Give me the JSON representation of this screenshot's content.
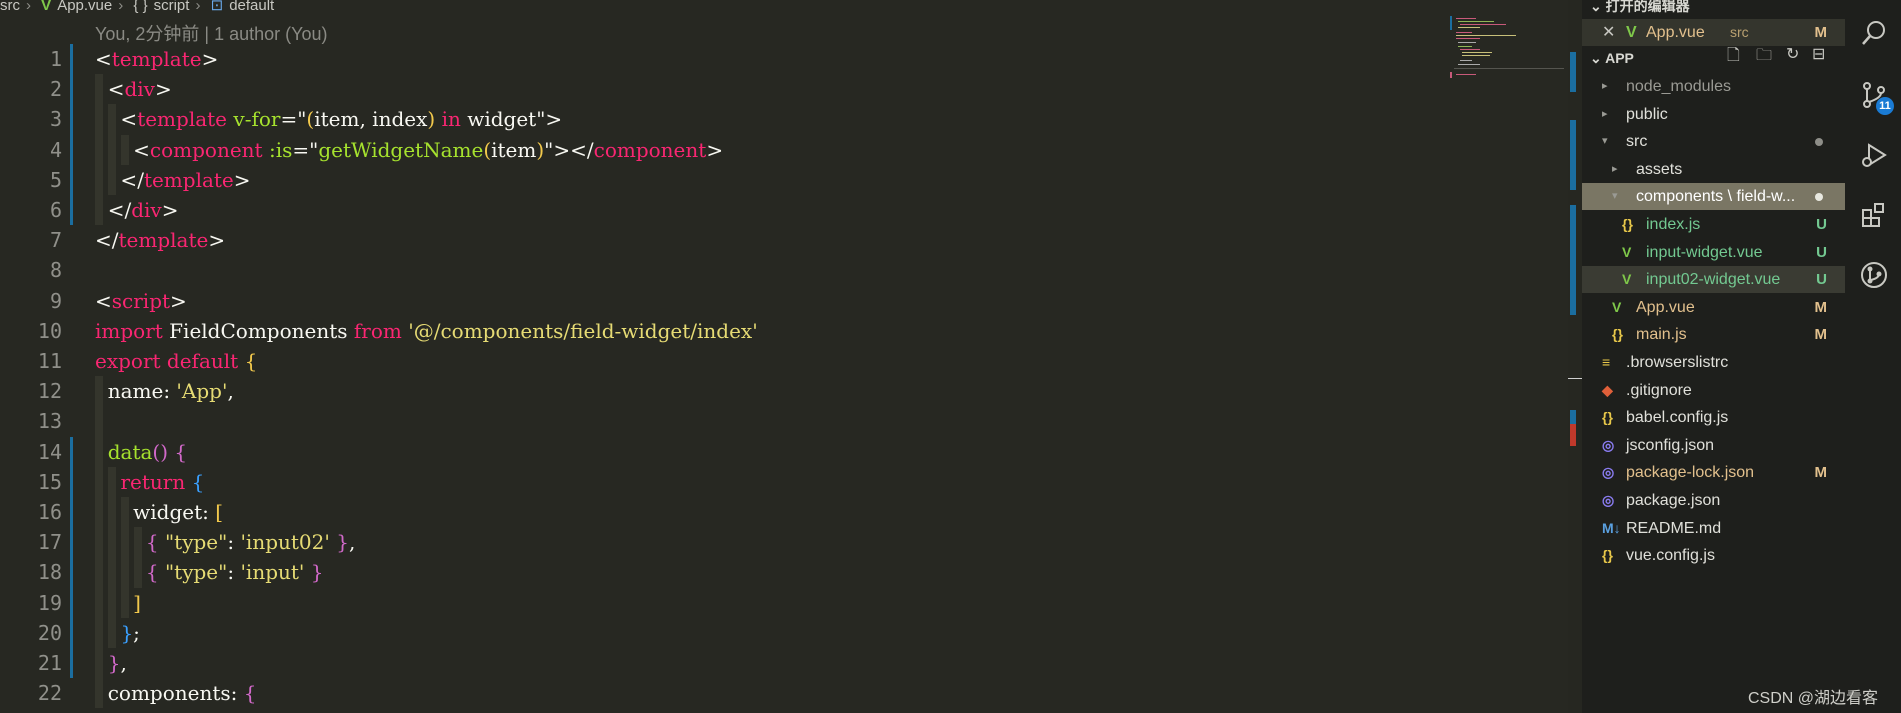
{
  "breadcrumb": {
    "src": "src",
    "file": "App.vue",
    "script_icon": "{ }",
    "script": "script",
    "default": "default"
  },
  "blame": "You, 2分钟前 | 1 author (You)",
  "lines": [
    {
      "n": "1",
      "toks": [
        [
          "pun",
          "<"
        ],
        [
          "tag",
          "template"
        ],
        [
          "pun",
          ">"
        ]
      ]
    },
    {
      "n": "2",
      "toks": [
        [
          "pun",
          "  <"
        ],
        [
          "tag",
          "div"
        ],
        [
          "pun",
          ">"
        ]
      ]
    },
    {
      "n": "3",
      "toks": [
        [
          "pun",
          "    <"
        ],
        [
          "tag",
          "template"
        ],
        [
          "pun",
          " "
        ],
        [
          "attr",
          "v-for"
        ],
        [
          "pun",
          "=\""
        ],
        [
          "yl",
          "("
        ],
        [
          "pun",
          "item, index"
        ],
        [
          "yl",
          ")"
        ],
        [
          "pun",
          " "
        ],
        [
          "kw",
          "in"
        ],
        [
          "pun",
          " widget\">"
        ]
      ]
    },
    {
      "n": "4",
      "toks": [
        [
          "pun",
          "      <"
        ],
        [
          "tag",
          "component"
        ],
        [
          "pun",
          " "
        ],
        [
          "attr",
          ":is"
        ],
        [
          "pun",
          "=\""
        ],
        [
          "fn",
          "getWidgetName"
        ],
        [
          "yl",
          "("
        ],
        [
          "pun",
          "item"
        ],
        [
          "yl",
          ")"
        ],
        [
          "pun",
          "\"></"
        ],
        [
          "tag",
          "component"
        ],
        [
          "pun",
          ">"
        ]
      ]
    },
    {
      "n": "5",
      "toks": [
        [
          "pun",
          "    </"
        ],
        [
          "tag",
          "template"
        ],
        [
          "pun",
          ">"
        ]
      ]
    },
    {
      "n": "6",
      "toks": [
        [
          "pun",
          "  </"
        ],
        [
          "tag",
          "div"
        ],
        [
          "pun",
          ">"
        ]
      ]
    },
    {
      "n": "7",
      "toks": [
        [
          "pun",
          "</"
        ],
        [
          "tag",
          "template"
        ],
        [
          "pun",
          ">"
        ]
      ]
    },
    {
      "n": "8",
      "toks": []
    },
    {
      "n": "9",
      "toks": [
        [
          "pun",
          "<"
        ],
        [
          "tag",
          "script"
        ],
        [
          "pun",
          ">"
        ]
      ]
    },
    {
      "n": "10",
      "toks": [
        [
          "kw",
          "import"
        ],
        [
          "pun",
          " FieldComponents "
        ],
        [
          "kw",
          "from"
        ],
        [
          "pun",
          " "
        ],
        [
          "str",
          "'@/components/field-widget/index'"
        ]
      ]
    },
    {
      "n": "11",
      "toks": [
        [
          "kw",
          "export default"
        ],
        [
          "pun",
          " "
        ],
        [
          "yl",
          "{"
        ]
      ]
    },
    {
      "n": "12",
      "toks": [
        [
          "pun",
          "  name: "
        ],
        [
          "str",
          "'App'"
        ],
        [
          "pun",
          ","
        ]
      ]
    },
    {
      "n": "13",
      "toks": []
    },
    {
      "n": "14",
      "toks": [
        [
          "pun",
          "  "
        ],
        [
          "fn",
          "data"
        ],
        [
          "br",
          "()"
        ],
        [
          "pun",
          " "
        ],
        [
          "br",
          "{"
        ]
      ]
    },
    {
      "n": "15",
      "toks": [
        [
          "pun",
          "    "
        ],
        [
          "kw",
          "return"
        ],
        [
          "pun",
          " "
        ],
        [
          "bb",
          "{"
        ]
      ]
    },
    {
      "n": "16",
      "toks": [
        [
          "pun",
          "      widget: "
        ],
        [
          "yl",
          "["
        ]
      ]
    },
    {
      "n": "17",
      "toks": [
        [
          "pun",
          "        "
        ],
        [
          "br",
          "{"
        ],
        [
          "pun",
          " "
        ],
        [
          "str",
          "\"type\""
        ],
        [
          "pun",
          ": "
        ],
        [
          "str",
          "'input02'"
        ],
        [
          "pun",
          " "
        ],
        [
          "br",
          "}"
        ],
        [
          "pun",
          ","
        ]
      ]
    },
    {
      "n": "18",
      "toks": [
        [
          "pun",
          "        "
        ],
        [
          "br",
          "{"
        ],
        [
          "pun",
          " "
        ],
        [
          "str",
          "\"type\""
        ],
        [
          "pun",
          ": "
        ],
        [
          "str",
          "'input'"
        ],
        [
          "pun",
          " "
        ],
        [
          "br",
          "}"
        ]
      ]
    },
    {
      "n": "19",
      "toks": [
        [
          "pun",
          "      "
        ],
        [
          "yl",
          "]"
        ]
      ]
    },
    {
      "n": "20",
      "toks": [
        [
          "pun",
          "    "
        ],
        [
          "bb",
          "}"
        ],
        [
          "pun",
          ";"
        ]
      ]
    },
    {
      "n": "21",
      "toks": [
        [
          "pun",
          "  "
        ],
        [
          "br",
          "}"
        ],
        [
          "pun",
          ","
        ]
      ]
    },
    {
      "n": "22",
      "toks": [
        [
          "pun",
          "  components: "
        ],
        [
          "br",
          "{"
        ]
      ]
    }
  ],
  "sidebar": {
    "open_editors_title": "打开的编辑器",
    "open_editor": {
      "name": "App.vue",
      "dir": "src",
      "badge": "M"
    },
    "project_title": "APP",
    "items": [
      {
        "label": "node_modules",
        "kind": "folder",
        "depth": 0,
        "color": "#9a9a94",
        "badge": ""
      },
      {
        "label": "public",
        "kind": "folder",
        "depth": 0,
        "color": "#e0e0da",
        "badge": ""
      },
      {
        "label": "src",
        "kind": "folder-open",
        "depth": 0,
        "color": "#e0e0da",
        "badge": "dot"
      },
      {
        "label": "assets",
        "kind": "folder",
        "depth": 1,
        "color": "#e0e0da",
        "badge": ""
      },
      {
        "label": "components \\ field-w...",
        "kind": "folder-open",
        "depth": 1,
        "color": "#ffffff",
        "badge": "dot",
        "selected": true
      },
      {
        "label": "index.js",
        "kind": "js",
        "depth": 2,
        "color": "#73c991",
        "badge": "U"
      },
      {
        "label": "input-widget.vue",
        "kind": "vue",
        "depth": 2,
        "color": "#73c991",
        "badge": "U"
      },
      {
        "label": "input02-widget.vue",
        "kind": "vue",
        "depth": 2,
        "color": "#73c991",
        "badge": "U",
        "hover": true
      },
      {
        "label": "App.vue",
        "kind": "vue",
        "depth": 1,
        "color": "#e2c08d",
        "badge": "M"
      },
      {
        "label": "main.js",
        "kind": "js",
        "depth": 1,
        "color": "#e2c08d",
        "badge": "M"
      },
      {
        "label": ".browserslistrc",
        "kind": "list",
        "depth": 0,
        "color": "#e0e0da",
        "badge": ""
      },
      {
        "label": ".gitignore",
        "kind": "git",
        "depth": 0,
        "color": "#e0e0da",
        "badge": ""
      },
      {
        "label": "babel.config.js",
        "kind": "js",
        "depth": 0,
        "color": "#e0e0da",
        "badge": ""
      },
      {
        "label": "jsconfig.json",
        "kind": "json",
        "depth": 0,
        "color": "#e0e0da",
        "badge": ""
      },
      {
        "label": "package-lock.json",
        "kind": "json",
        "depth": 0,
        "color": "#e2c08d",
        "badge": "M"
      },
      {
        "label": "package.json",
        "kind": "json",
        "depth": 0,
        "color": "#e0e0da",
        "badge": ""
      },
      {
        "label": "README.md",
        "kind": "md",
        "depth": 0,
        "color": "#e0e0da",
        "badge": ""
      },
      {
        "label": "vue.config.js",
        "kind": "js",
        "depth": 0,
        "color": "#e0e0da",
        "badge": ""
      }
    ]
  },
  "activity": {
    "scm_count": "11"
  },
  "watermark": "CSDN @湖边看客"
}
